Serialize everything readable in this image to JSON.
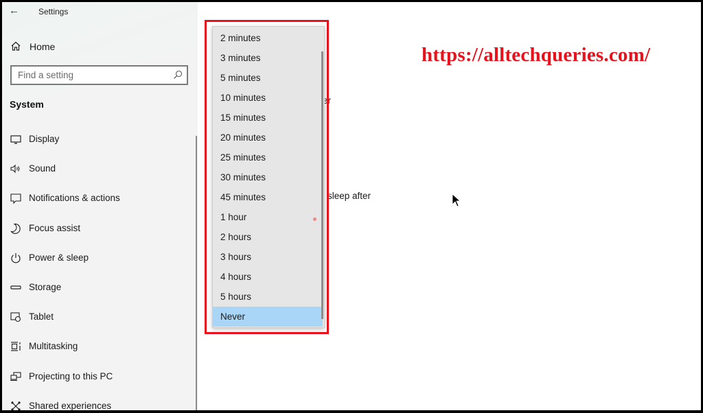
{
  "window": {
    "title": "Settings",
    "back_icon": "arrow-left-icon"
  },
  "sidebar": {
    "home_label": "Home",
    "home_icon": "home-icon",
    "search": {
      "placeholder": "Find a setting",
      "icon": "search-icon"
    },
    "section_title": "System",
    "items": [
      {
        "label": "Display",
        "icon": "monitor-icon"
      },
      {
        "label": "Sound",
        "icon": "speaker-icon"
      },
      {
        "label": "Notifications & actions",
        "icon": "notification-icon"
      },
      {
        "label": "Focus assist",
        "icon": "moon-icon"
      },
      {
        "label": "Power & sleep",
        "icon": "power-icon"
      },
      {
        "label": "Storage",
        "icon": "storage-icon"
      },
      {
        "label": "Tablet",
        "icon": "tablet-icon"
      },
      {
        "label": "Multitasking",
        "icon": "multitasking-icon"
      },
      {
        "label": "Projecting to this PC",
        "icon": "projecting-icon"
      },
      {
        "label": "Shared experiences",
        "icon": "shared-experiences-icon"
      }
    ]
  },
  "content": {
    "partial_text_1": "er",
    "partial_text_2": "sleep after"
  },
  "dropdown": {
    "selected": "Never",
    "options": [
      "2 minutes",
      "3 minutes",
      "5 minutes",
      "10 minutes",
      "15 minutes",
      "20 minutes",
      "25 minutes",
      "30 minutes",
      "45 minutes",
      "1 hour",
      "2 hours",
      "3 hours",
      "4 hours",
      "5 hours",
      "Never"
    ]
  },
  "watermark": {
    "text": "https://alltechqueries.com/",
    "color": "#e8121c"
  },
  "colors": {
    "highlight_box": "#e8121c",
    "selected_option": "#a9d6f7",
    "sidebar_bg": "#f3f3f3",
    "dropdown_bg": "#e6e6e6"
  }
}
